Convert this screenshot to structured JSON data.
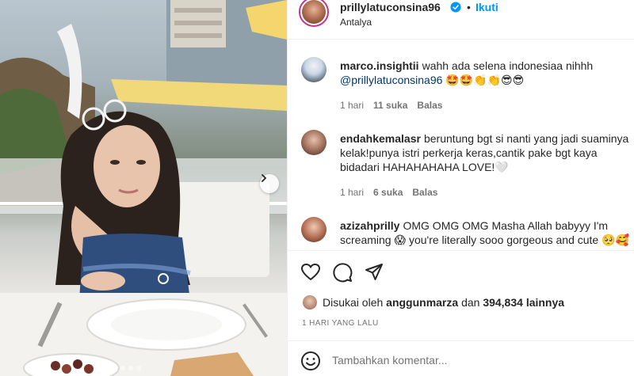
{
  "post": {
    "username": "prillylatuconsina96",
    "separator": "•",
    "follow_label": "Ikuti",
    "location": "Antalya",
    "carousel_dots": 4,
    "carousel_active_index": 0,
    "verified_icon": "verified-badge-icon",
    "next_icon": "chevron-right-icon"
  },
  "comments": [
    {
      "username": "marco.insightii",
      "text": "wahh ada selena indonesiaa nihhh",
      "mention": "@prillylatuconsina96",
      "emoji": "🤩🤩👏👏😎😎",
      "time": "1 hari",
      "likes": "11 suka",
      "reply": "Balas"
    },
    {
      "username": "endahkemalasr",
      "text": "beruntung bgt si nanti yang jadi suaminya kelak!punya istri perkerja keras,cantik pake bgt kaya bidadari HAHAHAHAHA LOVE!🤍",
      "time": "1 hari",
      "likes": "6 suka",
      "reply": "Balas"
    },
    {
      "username": "azizahprilly",
      "text": "OMG OMG OMG Masha Allah babyyy I'm screaming 😱 you're literally sooo gorgeous and cute 🥺🥰"
    }
  ],
  "actions": {
    "like_icon": "heart-icon",
    "comment_icon": "comment-icon",
    "share_icon": "share-icon"
  },
  "likes": {
    "prefix": "Disukai oleh",
    "user": "anggunmarza",
    "middle": "dan",
    "count": "394,834",
    "suffix": "lainnya"
  },
  "time_ago": "1 HARI YANG LALU",
  "add_comment": {
    "placeholder": "Tambahkan komentar...",
    "emoji_icon": "emoji-icon"
  },
  "colors": {
    "link_blue": "#0095f6",
    "mention_blue": "#00376b",
    "muted": "#737373",
    "text": "#262626",
    "story_ring": "#c13584"
  }
}
